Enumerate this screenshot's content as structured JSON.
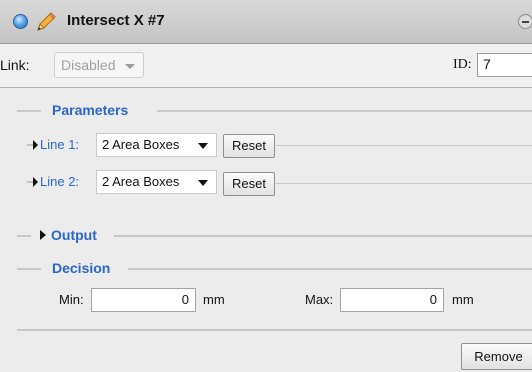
{
  "window": {
    "title": "Intersect X #7",
    "status_icon": "blue-status-dot",
    "tool_icon": "pencil-icon",
    "collapse_icon": "minus-icon"
  },
  "link_row": {
    "link_label": "Link:",
    "link_value": "Disabled",
    "id_label": "ID:",
    "id_value": "7"
  },
  "sections": {
    "parameters": "Parameters",
    "output": "Output",
    "decision": "Decision"
  },
  "parameters": {
    "line1_label": "Line 1:",
    "line1_value": "2 Area Boxes",
    "line2_label": "Line 2:",
    "line2_value": "2 Area Boxes",
    "reset_label": "Reset"
  },
  "decision": {
    "min_label": "Min:",
    "min_value": "0",
    "max_label": "Max:",
    "max_value": "0",
    "unit": "mm"
  },
  "footer": {
    "remove_label": "Remove"
  },
  "colors": {
    "accent": "#2a67c8",
    "background": "#ececec"
  }
}
